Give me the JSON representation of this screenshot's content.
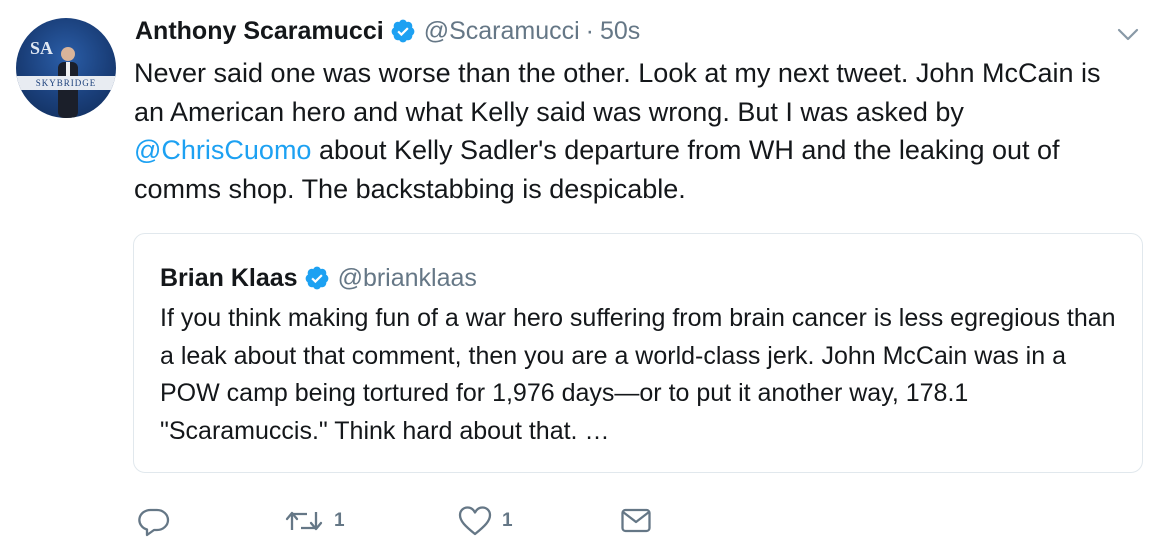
{
  "tweet": {
    "author_name": "Anthony Scaramucci",
    "author_handle": "@Scaramucci",
    "separator": "·",
    "timestamp": "50s",
    "avatar_banner_text": "SKYBRIDGE",
    "avatar_logo_text": "SA",
    "text_before_mention": "Never said one was worse than the other. Look at my next tweet. John McCain is an American hero and what Kelly said was wrong. But I was asked by ",
    "mention": "@ChrisCuomo",
    "text_after_mention": " about Kelly Sadler's departure from WH and the leaking out of comms shop. The backstabbing is despicable."
  },
  "quoted_tweet": {
    "author_name": "Brian Klaas",
    "author_handle": "@brianklaas",
    "text": "If you think making fun of a war hero suffering from brain cancer is less egregious than a leak about that comment, then you are a world-class jerk. John McCain was in a POW camp being tortured for 1,976 days—or to put it another way, 178.1 \"Scaramuccis.\" Think hard about that. …"
  },
  "actions": {
    "reply_icon": "reply-icon",
    "retweet_icon": "retweet-icon",
    "retweet_count": "1",
    "like_icon": "heart-icon",
    "like_count": "1",
    "dm_icon": "envelope-icon"
  },
  "colors": {
    "accent": "#1da1f2",
    "secondary_text": "#657786",
    "primary_text": "#14171a",
    "border": "#e1e8ed"
  }
}
